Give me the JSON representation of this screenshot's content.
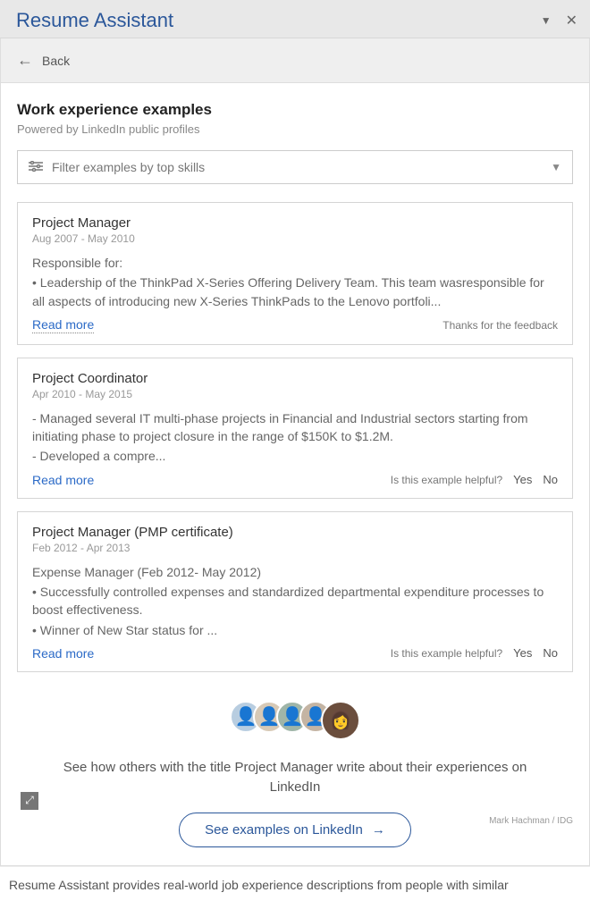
{
  "header": {
    "title": "Resume Assistant"
  },
  "back": {
    "label": "Back"
  },
  "section": {
    "title": "Work experience examples",
    "subtitle": "Powered by LinkedIn public profiles"
  },
  "filter": {
    "placeholder": "Filter examples by top skills"
  },
  "examples": [
    {
      "title": "Project Manager",
      "dates": "Aug 2007 - May 2010",
      "body_line1": "Responsible for:",
      "body_line2": "• Leadership of the ThinkPad X-Series Offering Delivery Team. This team wasresponsible for all aspects of introducing new X-Series ThinkPads to the Lenovo portfoli...",
      "read_more": "Read more",
      "feedback_text": "Thanks for the feedback",
      "show_yn": false
    },
    {
      "title": "Project Coordinator",
      "dates": "Apr 2010 - May 2015",
      "body_line1": "- Managed several IT multi-phase projects in Financial and Industrial sectors starting from initiating phase to project closure in the range of $150K to $1.2M.",
      "body_line2": "- Developed a compre...",
      "read_more": "Read more",
      "feedback_text": "Is this example helpful?",
      "show_yn": true
    },
    {
      "title": "Project Manager (PMP certificate)",
      "dates": "Feb 2012 - Apr 2013",
      "body_line1": "Expense Manager (Feb 2012- May 2012)",
      "body_line2": "• Successfully controlled expenses and standardized departmental expenditure processes to boost effectiveness.",
      "body_line3": "• Winner of New Star status for ...",
      "read_more": "Read more",
      "feedback_text": "Is this example helpful?",
      "show_yn": true
    }
  ],
  "feedback_yes": "Yes",
  "feedback_no": "No",
  "promo": {
    "text": "See how others with the title Project Manager write about their experiences on LinkedIn",
    "button": "See examples on LinkedIn"
  },
  "credit": "Mark Hachman / IDG",
  "caption": "Resume Assistant provides real-world job experience descriptions from people with similar"
}
